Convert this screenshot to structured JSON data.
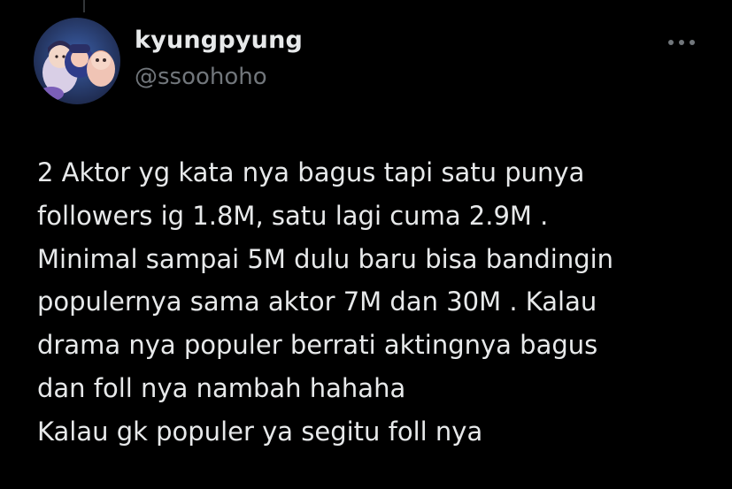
{
  "author": {
    "display_name": "kyungpyung",
    "handle": "@ssoohoho",
    "avatar_icon": "avatar-image"
  },
  "more_icon": "ellipsis-icon",
  "tweet": {
    "lines": [
      "2 Aktor yg kata nya bagus tapi satu punya",
      "followers ig 1.8M, satu lagi cuma 2.9M .",
      "Minimal sampai 5M dulu baru bisa bandingin",
      "populernya sama aktor 7M dan 30M . Kalau",
      "drama nya populer berrati aktingnya bagus",
      "dan foll nya nambah hahaha",
      "Kalau gk populer ya segitu foll nya"
    ]
  },
  "colors": {
    "background": "#000000",
    "primary_text": "#e7e9ea",
    "secondary_text": "#71767b"
  }
}
